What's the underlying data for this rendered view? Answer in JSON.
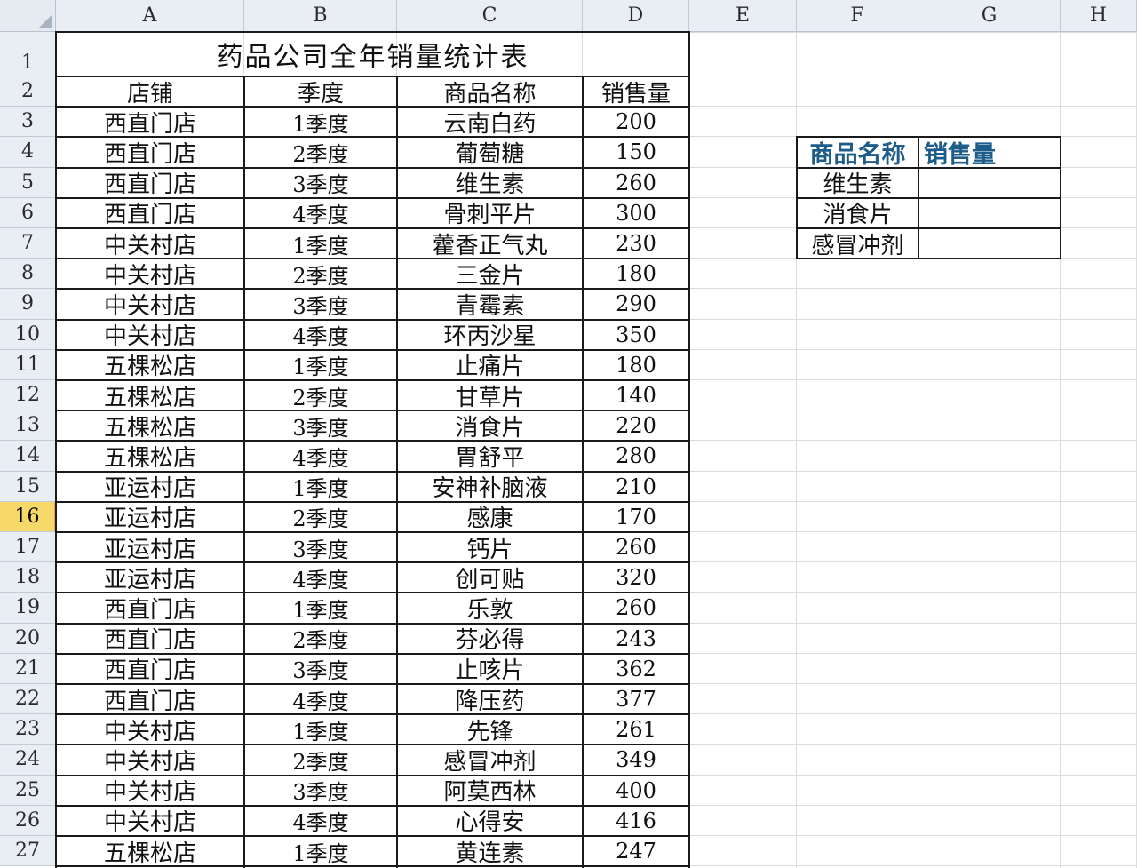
{
  "columns": [
    "A",
    "B",
    "C",
    "D",
    "E",
    "F",
    "G",
    "H"
  ],
  "rows": [
    "1",
    "2",
    "3",
    "4",
    "5",
    "6",
    "7",
    "8",
    "9",
    "10",
    "11",
    "12",
    "13",
    "14",
    "15",
    "16",
    "17",
    "18",
    "19",
    "20",
    "21",
    "22",
    "23",
    "24",
    "25",
    "26",
    "27"
  ],
  "active_row": "16",
  "title": "药品公司全年销量统计表",
  "headers": [
    "店铺",
    "季度",
    "商品名称",
    "销售量"
  ],
  "data": [
    [
      "西直门店",
      "1季度",
      "云南白药",
      "200"
    ],
    [
      "西直门店",
      "2季度",
      "葡萄糖",
      "150"
    ],
    [
      "西直门店",
      "3季度",
      "维生素",
      "260"
    ],
    [
      "西直门店",
      "4季度",
      "骨刺平片",
      "300"
    ],
    [
      "中关村店",
      "1季度",
      "藿香正气丸",
      "230"
    ],
    [
      "中关村店",
      "2季度",
      "三金片",
      "180"
    ],
    [
      "中关村店",
      "3季度",
      "青霉素",
      "290"
    ],
    [
      "中关村店",
      "4季度",
      "环丙沙星",
      "350"
    ],
    [
      "五棵松店",
      "1季度",
      "止痛片",
      "180"
    ],
    [
      "五棵松店",
      "2季度",
      "甘草片",
      "140"
    ],
    [
      "五棵松店",
      "3季度",
      "消食片",
      "220"
    ],
    [
      "五棵松店",
      "4季度",
      "胃舒平",
      "280"
    ],
    [
      "亚运村店",
      "1季度",
      "安神补脑液",
      "210"
    ],
    [
      "亚运村店",
      "2季度",
      "感康",
      "170"
    ],
    [
      "亚运村店",
      "3季度",
      "钙片",
      "260"
    ],
    [
      "亚运村店",
      "4季度",
      "创可贴",
      "320"
    ],
    [
      "西直门店",
      "1季度",
      "乐敦",
      "260"
    ],
    [
      "西直门店",
      "2季度",
      "芬必得",
      "243"
    ],
    [
      "西直门店",
      "3季度",
      "止咳片",
      "362"
    ],
    [
      "西直门店",
      "4季度",
      "降压药",
      "377"
    ],
    [
      "中关村店",
      "1季度",
      "先锋",
      "261"
    ],
    [
      "中关村店",
      "2季度",
      "感冒冲剂",
      "349"
    ],
    [
      "中关村店",
      "3季度",
      "阿莫西林",
      "400"
    ],
    [
      "中关村店",
      "4季度",
      "心得安",
      "416"
    ],
    [
      "五棵松店",
      "1季度",
      "黄连素",
      "247"
    ]
  ],
  "lookup": {
    "headers": [
      "商品名称",
      "销售量"
    ],
    "items": [
      "维生素",
      "消食片",
      "感冒冲剂"
    ],
    "header_color": "#1e5c8a"
  }
}
